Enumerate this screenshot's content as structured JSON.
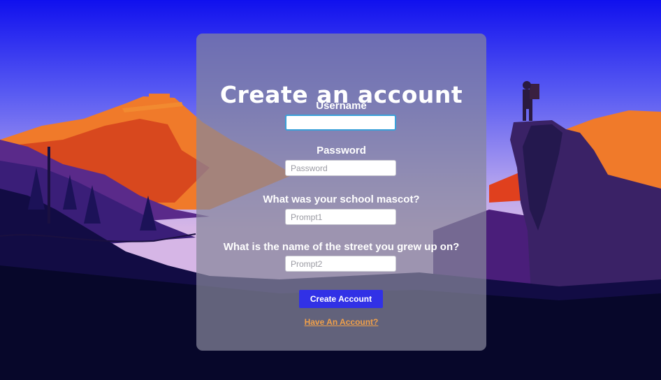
{
  "form": {
    "title": "Create an account",
    "username_label": "Username",
    "username_value": "",
    "password_label": "Password",
    "password_placeholder": "Password",
    "prompt1_label": "What was your school mascot?",
    "prompt1_placeholder": "Prompt1",
    "prompt2_label": "What is the name of the street you grew up on?",
    "prompt2_placeholder": "Prompt2",
    "submit_label": "Create Account",
    "login_link": "Have An Account?"
  },
  "colors": {
    "sky_top": "#1414f0",
    "button": "#3131e6",
    "link": "#f0a04a",
    "focus_border": "#3aa0d8"
  }
}
